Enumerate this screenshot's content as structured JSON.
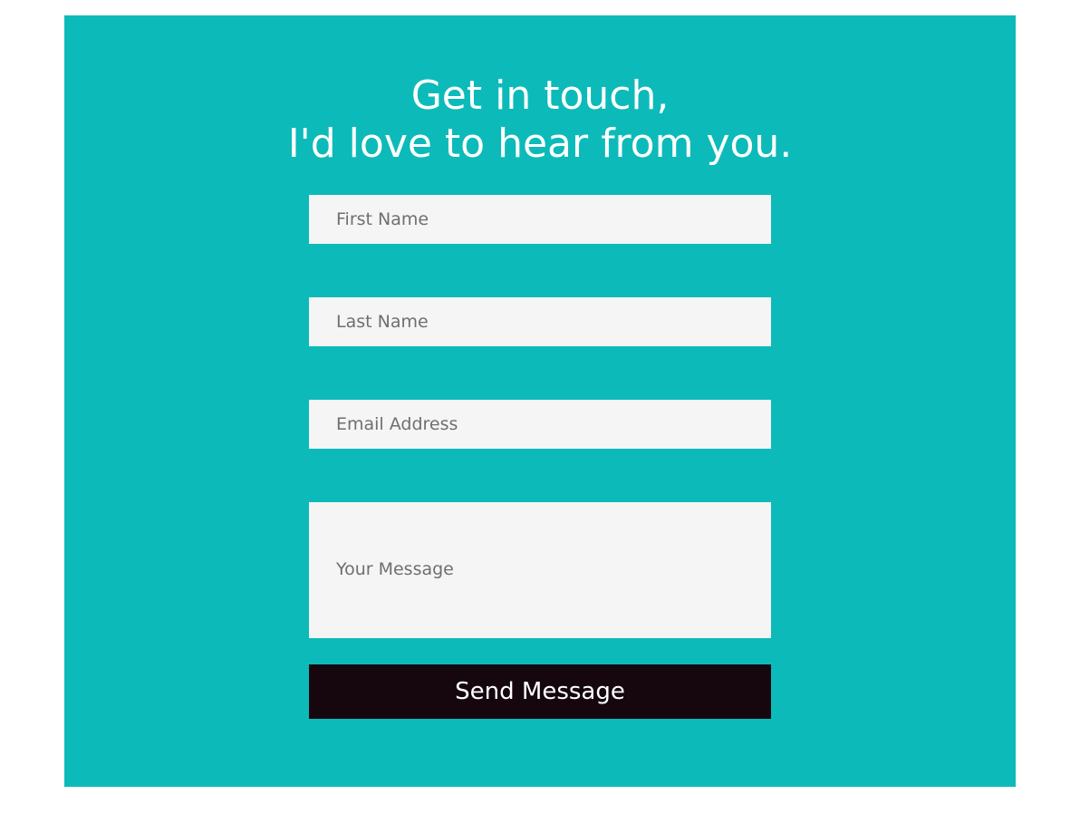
{
  "heading": {
    "line1": "Get in touch,",
    "line2": "I'd love to hear from you."
  },
  "form": {
    "first_name_placeholder": "First Name",
    "first_name_value": "",
    "last_name_placeholder": "Last Name",
    "last_name_value": "",
    "email_placeholder": "Email Address",
    "email_value": "",
    "message_placeholder": "Your Message",
    "message_value": "",
    "submit_label": "Send Message"
  },
  "colors": {
    "panel_background": "#0dbaba",
    "field_background": "#f5f5f5",
    "button_background": "#16070f",
    "heading_text": "#ffffff"
  }
}
